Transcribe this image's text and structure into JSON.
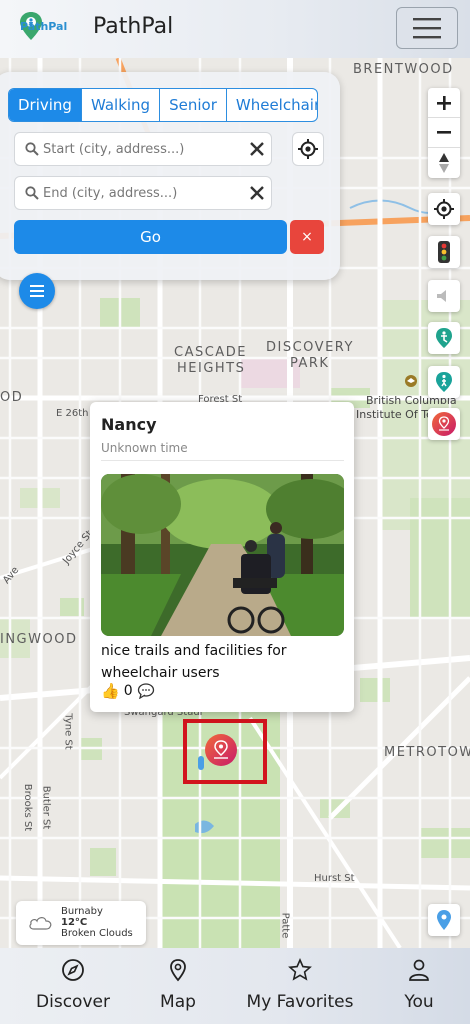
{
  "header": {
    "logo_text": "PathPal",
    "title": "PathPal",
    "menu_icon": "hamburger-icon"
  },
  "route_panel": {
    "modes": [
      {
        "label": "Driving",
        "active": true
      },
      {
        "label": "Walking",
        "active": false
      },
      {
        "label": "Senior",
        "active": false
      },
      {
        "label": "Wheelchair",
        "active": false
      }
    ],
    "start_placeholder": "Start (city, address...)",
    "end_placeholder": "End (city, address...)",
    "go_label": "Go",
    "cancel_label": "×"
  },
  "map": {
    "labels": {
      "brentwood": "BRENTWOOD",
      "cascade_heights_1": "CASCADE",
      "cascade_heights_2": "HEIGHTS",
      "discovery_park_1": "DISCOVERY",
      "discovery_park_2": "PARK",
      "bcit_1": "British Columbia",
      "bcit_2": "Institute Of Te",
      "metrotown": "METROTOW",
      "edgewood": "INGWOOD",
      "od": "OD"
    },
    "streets": {
      "e26th": "E 26th",
      "forest": "Forest St",
      "joyce": "Joyce St",
      "ave": "Ave",
      "tyne": "Tyne St",
      "brooks": "Brooks St",
      "butler": "Butler St",
      "hurst": "Hurst St",
      "patterson": "Patte",
      "swangard": "Swangard Stadi"
    },
    "accent": "#1d8ae8",
    "marker_gradient": [
      "#f0693a",
      "#c81a6a"
    ],
    "selection_color": "#d2141d"
  },
  "popup": {
    "name": "Nancy",
    "time": "Unknown time",
    "caption": "nice trails and facilities for wheelchair users",
    "likes": "0"
  },
  "weather": {
    "city": "Burnaby",
    "temp": "12°C",
    "condition": "Broken Clouds"
  },
  "bottom_nav": {
    "discover": "Discover",
    "map": "Map",
    "favorites": "My Favorites",
    "you": "You"
  }
}
